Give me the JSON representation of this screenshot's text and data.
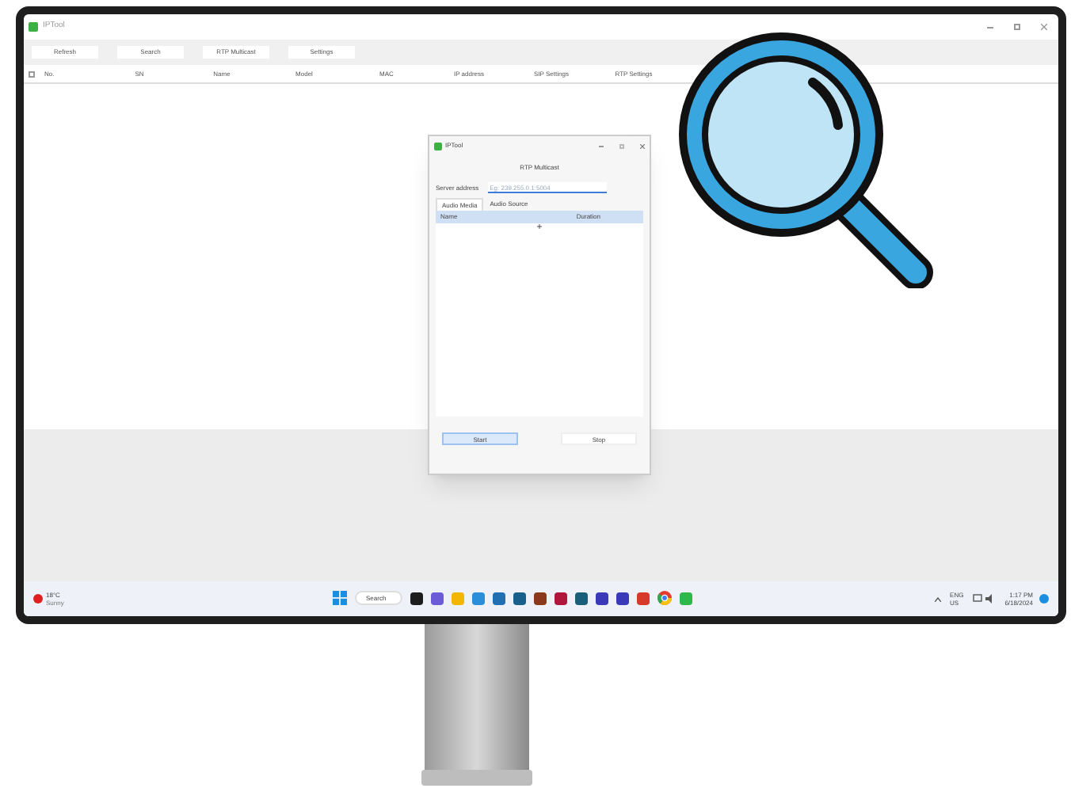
{
  "window": {
    "title": "IPTool"
  },
  "toolbar": [
    "Refresh",
    "Search",
    "RTP Multicast",
    "Settings"
  ],
  "table": {
    "select_all_checked": false,
    "columns": [
      "No.",
      "SN",
      "Name",
      "Model",
      "MAC",
      "IP address",
      "SIP Settings",
      "RTP Settings"
    ]
  },
  "dialog": {
    "title": "IPTool",
    "heading": "RTP Multicast",
    "server_label": "Server address",
    "server_placeholder": "Eg: 239.255.0.1:5004",
    "tabs": [
      {
        "label": "Audio Media",
        "selected": true
      },
      {
        "label": "Audio Source",
        "selected": false
      }
    ],
    "columns": [
      "Name",
      "Duration"
    ],
    "add": "+",
    "buttons": [
      {
        "label": "Start",
        "kind": "primary"
      },
      {
        "label": "Stop",
        "kind": "secondary"
      }
    ]
  },
  "taskbar": {
    "weather": [
      "18°C",
      "Sunny"
    ],
    "search": "Search",
    "tray": [
      "ENG",
      "US"
    ],
    "clock": [
      "1:17 PM",
      "6/18/2024"
    ]
  }
}
